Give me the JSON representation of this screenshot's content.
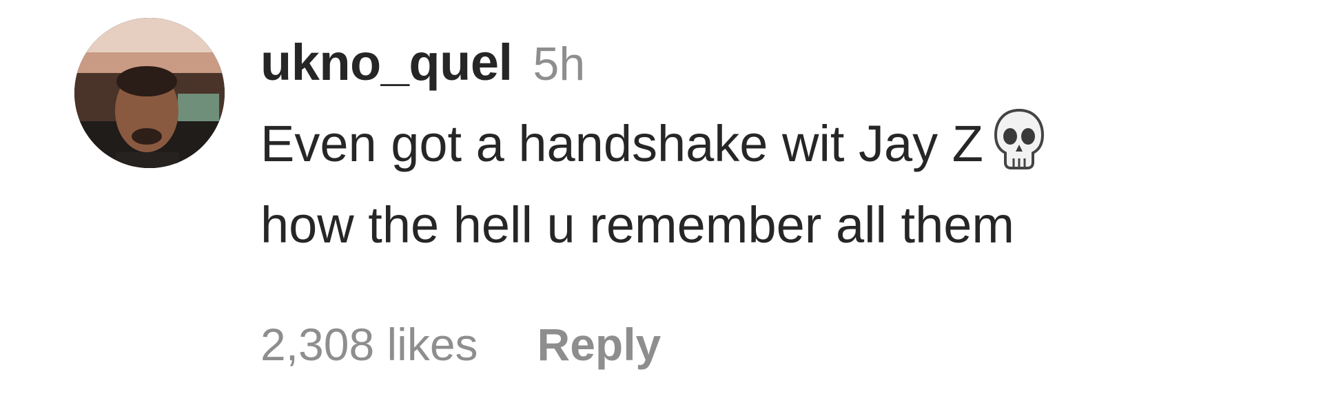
{
  "comment": {
    "username": "ukno_quel",
    "timestamp": "5h",
    "text_line1": "Even got a handshake wit Jay Z",
    "emoji": "skull-emoji",
    "text_line2": "how the hell u remember all them",
    "likes": "2,308 likes",
    "reply_label": "Reply"
  },
  "colors": {
    "primary_text": "#262626",
    "secondary_text": "#8e8e8e",
    "background": "#ffffff"
  }
}
